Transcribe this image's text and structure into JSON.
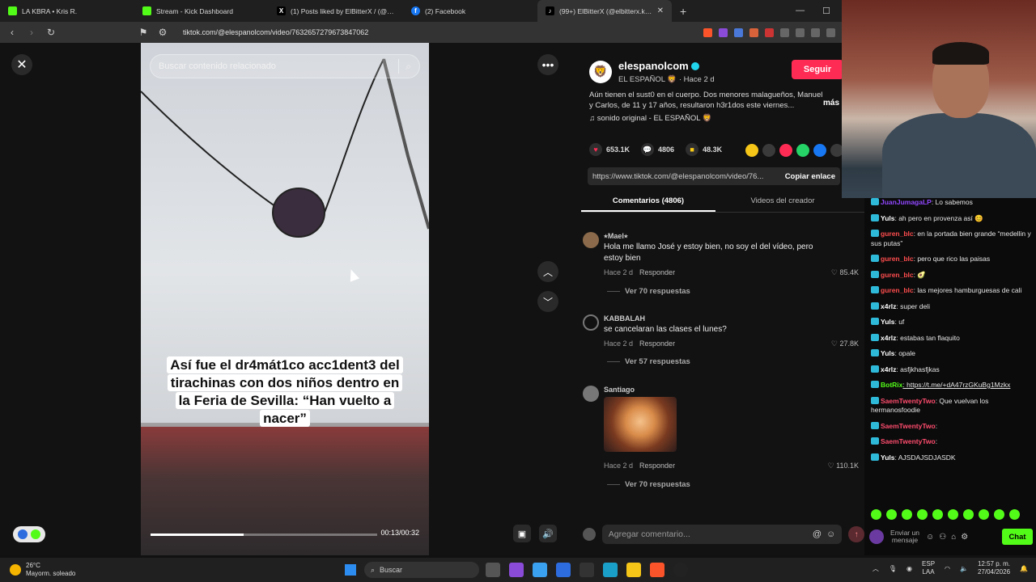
{
  "browser": {
    "tabs": [
      {
        "title": "LA KBRA • Kris R.",
        "fav_color": "#53fc18",
        "active": false
      },
      {
        "title": "Stream - Kick Dashboard",
        "fav_color": "#53fc18",
        "active": false
      },
      {
        "title": "(1) Posts liked by ElBitterX / (@ElBi",
        "fav_color": "#000000",
        "active": false
      },
      {
        "title": "(2) Facebook",
        "fav_color": "#1877f2",
        "active": false
      },
      {
        "title": "(99+) ElBitterX (@elbitterx.kick",
        "fav_color": "#000000",
        "active": true
      }
    ],
    "url": "tiktok.com/@elespanolcom/video/7632657279673847062"
  },
  "video": {
    "search_placeholder": "Buscar contenido relacionado",
    "caption": "Así fue el dr4mát1co acc1dent3 del tirachinas con dos niños dentro en la Feria de Sevilla: “Han vuelto a nacer”",
    "timecode": "00:13/00:32",
    "progress_fraction": 0.41
  },
  "post": {
    "author": "elespanolcom",
    "author_sub": "EL ESPAÑOL 🦁 · Hace 2 d",
    "follow_label": "Seguir",
    "description": "Aún tienen el sust0 en el cuerpo. Dos menores malagueños, Manuel y Carlos, de 11 y 17 años, resultaron h3r1dos este viernes...",
    "more_label": "más",
    "sound": "♫  sonido original - EL ESPAÑOL 🦁",
    "likes": "653.1K",
    "comments": "4806",
    "saves": "48.3K",
    "link": "https://www.tiktok.com/@elespanolcom/video/76...",
    "copy_label": "Copiar enlace",
    "tab_comments": "Comentarios (4806)",
    "tab_videos": "Videos del creador"
  },
  "comments": [
    {
      "user": "⭑Mael⭑",
      "text": "Hola me llamo José y estoy bien, no soy el del vídeo, pero estoy bien",
      "time": "Hace 2 d",
      "reply": "Responder",
      "likes": "85.4K",
      "replies": "Ver 70 respuestas"
    },
    {
      "user": "KABBALAH",
      "text": "se cancelaran las clases el lunes?",
      "time": "Hace 2 d",
      "reply": "Responder",
      "likes": "27.8K",
      "replies": "Ver 57 respuestas"
    },
    {
      "user": "Santiago",
      "text": "",
      "time": "Hace 2 d",
      "reply": "Responder",
      "likes": "110.1K",
      "replies": "Ver 70 respuestas"
    }
  ],
  "comment_input_placeholder": "Agregar comentario...",
  "chat": {
    "messages": [
      {
        "user": "JuanJumagaLP",
        "text": ": Lo sabemos",
        "color": "#9147ff"
      },
      {
        "user": "Yuls",
        "text": ": ah pero en provenza así 😊",
        "color": "#ffffff"
      },
      {
        "user": "guren_blc",
        "text": ": en la portada bien grande “medellin y sus putas”",
        "color": "#ff4d4d"
      },
      {
        "user": "guren_blc",
        "text": ": pero que rico las paisas",
        "color": "#ff4d4d"
      },
      {
        "user": "guren_blc",
        "text": ": 🥑",
        "color": "#ff4d4d"
      },
      {
        "user": "guren_blc",
        "text": ": las mejores hamburguesas de cali",
        "color": "#ff4d4d"
      },
      {
        "user": "x4rlz",
        "text": ": super deli",
        "color": "#ffffff"
      },
      {
        "user": "Yuls",
        "text": ": uf",
        "color": "#ffffff"
      },
      {
        "user": "x4rlz",
        "text": ": estabas tan flaquito",
        "color": "#ffffff"
      },
      {
        "user": "Yuls",
        "text": ": opale",
        "color": "#ffffff"
      },
      {
        "user": "x4rlz",
        "text": ": asfjkhasfjkas",
        "color": "#ffffff"
      },
      {
        "user": "BotRix",
        "text": ": https://t.me/+dA47rzGKuBg1Mzkx",
        "color": "#53fc18"
      },
      {
        "user": "SaemTwentyTwo",
        "text": ": Que vuelvan los hermanosfoodie",
        "color": "#ff4d6d"
      },
      {
        "user": "SaemTwentyTwo",
        "text": ":",
        "color": "#ff4d6d"
      },
      {
        "user": "SaemTwentyTwo",
        "text": ":",
        "color": "#ff4d6d"
      },
      {
        "user": "Yuls",
        "text": ": AJSDAJSDJASDK",
        "color": "#ffffff"
      }
    ],
    "input_placeholder": "Enviar un mensaje",
    "chat_button": "Chat"
  },
  "taskbar": {
    "temp": "26°C",
    "weather": "Mayorm. soleado",
    "search_label": "Buscar",
    "lang_top": "ESP",
    "lang_bottom": "LAA",
    "time": "12:57 p. m.",
    "date": "27/04/2026"
  },
  "colors": {
    "accent_tiktok": "#fe2c55",
    "kick_green": "#53fc18"
  }
}
